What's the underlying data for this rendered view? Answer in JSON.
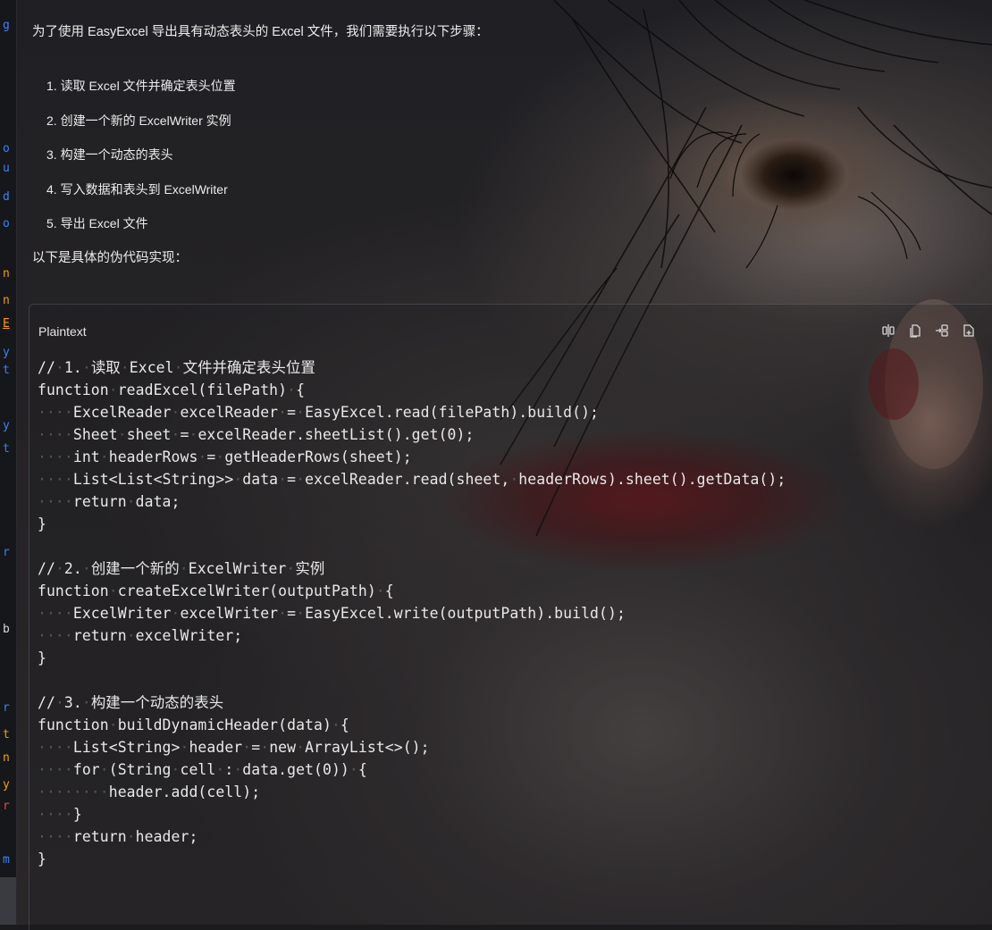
{
  "gutter": {
    "letters": [
      "g",
      "o",
      "u",
      "d",
      "o",
      "n",
      "n",
      "E",
      "y",
      "t",
      "y",
      "t",
      "r",
      "b",
      "r",
      "t",
      "n",
      "y",
      "r",
      "m"
    ]
  },
  "message": {
    "intro": "为了使用 EasyExcel 导出具有动态表头的 Excel 文件，我们需要执行以下步骤：",
    "steps": [
      "1. 读取 Excel 文件并确定表头位置",
      "2. 创建一个新的 ExcelWriter 实例",
      "3. 构建一个动态的表头",
      "4. 写入数据和表头到 ExcelWriter",
      "5. 导出 Excel 文件"
    ],
    "outro": "以下是具体的伪代码实现："
  },
  "code_block": {
    "language": "Plaintext",
    "tools": [
      "split-view-icon",
      "copy-icon",
      "insert-icon",
      "new-file-icon"
    ],
    "lines": [
      "// 1. 读取 Excel 文件并确定表头位置",
      "function readExcel(filePath) {",
      "    ExcelReader excelReader = EasyExcel.read(filePath).build();",
      "    Sheet sheet = excelReader.sheetList().get(0);",
      "    int headerRows = getHeaderRows(sheet);",
      "    List<List<String>> data = excelReader.read(sheet, headerRows).sheet().getData();",
      "    return data;",
      "}",
      "",
      "// 2. 创建一个新的 ExcelWriter 实例",
      "function createExcelWriter(outputPath) {",
      "    ExcelWriter excelWriter = EasyExcel.write(outputPath).build();",
      "    return excelWriter;",
      "}",
      "",
      "// 3. 构建一个动态的表头",
      "function buildDynamicHeader(data) {",
      "    List<String> header = new ArrayList<>();",
      "    for (String cell : data.get(0)) {",
      "        header.add(cell);",
      "    }",
      "    return header;",
      "}"
    ]
  },
  "colors": {
    "gutter_letter_blue": "#3b82f6",
    "gutter_letter_orange": "#f59e0b",
    "gutter_letter_red": "#ef4444"
  }
}
